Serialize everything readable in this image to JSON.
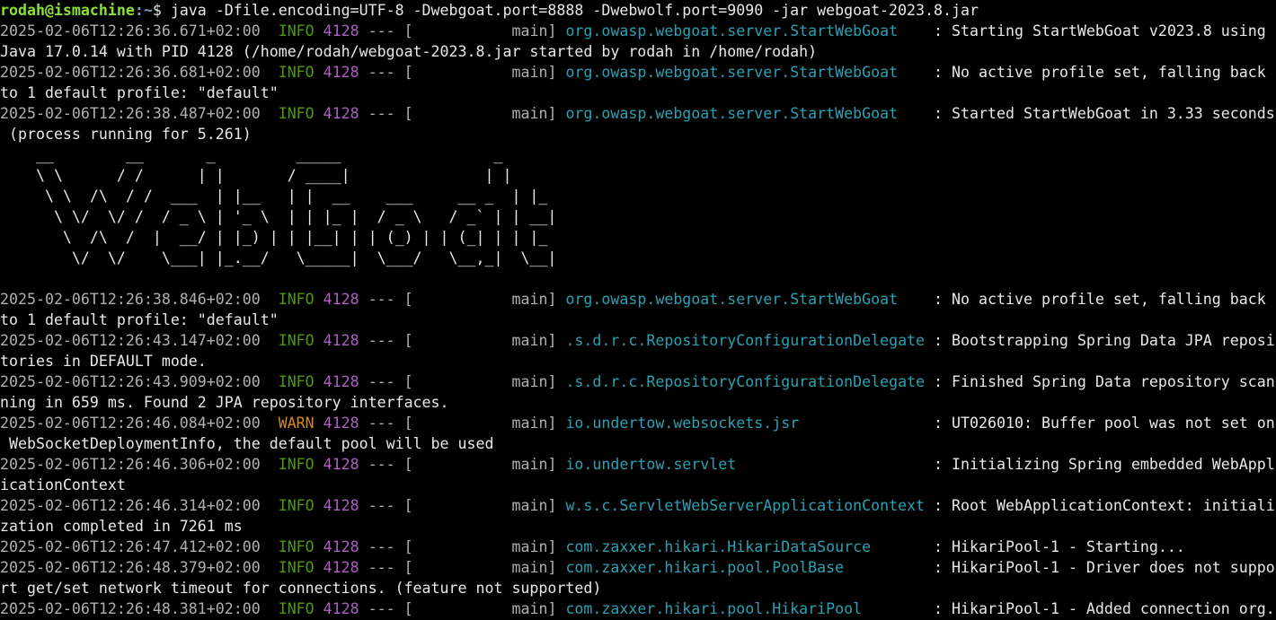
{
  "prompt": {
    "user_host": "rodah@ismachine",
    "path": ":~",
    "symbol": "$ ",
    "command": "java -Dfile.encoding=UTF-8 -Dwebgoat.port=8888 -Dwebwolf.port=9090 -jar webgoat-2023.8.jar"
  },
  "log_entries": [
    {
      "timestamp": "2025-02-06T12:26:36.671+02:00",
      "level": "INFO",
      "pid": "4128",
      "thread": "main",
      "logger": "org.owasp.webgoat.server.StartWebGoat",
      "message": "Starting StartWebGoat v2023.8 using",
      "continuation": "Java 17.0.14 with PID 4128 (/home/rodah/webgoat-2023.8.jar started by rodah in /home/rodah)"
    },
    {
      "timestamp": "2025-02-06T12:26:36.681+02:00",
      "level": "INFO",
      "pid": "4128",
      "thread": "main",
      "logger": "org.owasp.webgoat.server.StartWebGoat",
      "message": "No active profile set, falling back",
      "continuation": "to 1 default profile: \"default\""
    },
    {
      "timestamp": "2025-02-06T12:26:38.487+02:00",
      "level": "INFO",
      "pid": "4128",
      "thread": "main",
      "logger": "org.owasp.webgoat.server.StartWebGoat",
      "message": "Started StartWebGoat in 3.33 seconds",
      "continuation": " (process running for 5.261)"
    }
  ],
  "banner": [
    "    __        __       _         _____                 _   ",
    "    \\ \\      / /      | |       / ____|               | |  ",
    "     \\ \\  /\\  / /  ___  | |__   | |  __    ___     __ _  | |_ ",
    "      \\ \\/  \\/ /  / _ \\ | '_ \\  | | |_ |  / _ \\   / _` | | __|",
    "       \\  /\\  /  |  __/ | |_) | | |__| | | (_) | | (_| | | |_ ",
    "        \\/  \\/    \\___| |_.__/   \\_____|  \\___/   \\__,_|  \\__|",
    ""
  ],
  "log_entries_2": [
    {
      "timestamp": "2025-02-06T12:26:38.846+02:00",
      "level": "INFO",
      "pid": "4128",
      "thread": "main",
      "logger": "org.owasp.webgoat.server.StartWebGoat",
      "message": "No active profile set, falling back",
      "continuation": "to 1 default profile: \"default\""
    },
    {
      "timestamp": "2025-02-06T12:26:43.147+02:00",
      "level": "INFO",
      "pid": "4128",
      "thread": "main",
      "logger": ".s.d.r.c.RepositoryConfigurationDelegate",
      "message": "Bootstrapping Spring Data JPA reposi",
      "continuation": "tories in DEFAULT mode."
    },
    {
      "timestamp": "2025-02-06T12:26:43.909+02:00",
      "level": "INFO",
      "pid": "4128",
      "thread": "main",
      "logger": ".s.d.r.c.RepositoryConfigurationDelegate",
      "message": "Finished Spring Data repository scan",
      "continuation": "ning in 659 ms. Found 2 JPA repository interfaces."
    },
    {
      "timestamp": "2025-02-06T12:26:46.084+02:00",
      "level": "WARN",
      "pid": "4128",
      "thread": "main",
      "logger": "io.undertow.websockets.jsr",
      "message": "UT026010: Buffer pool was not set on",
      "continuation": " WebSocketDeploymentInfo, the default pool will be used"
    },
    {
      "timestamp": "2025-02-06T12:26:46.306+02:00",
      "level": "INFO",
      "pid": "4128",
      "thread": "main",
      "logger": "io.undertow.servlet",
      "message": "Initializing Spring embedded WebAppl",
      "continuation": "icationContext"
    },
    {
      "timestamp": "2025-02-06T12:26:46.314+02:00",
      "level": "INFO",
      "pid": "4128",
      "thread": "main",
      "logger": "w.s.c.ServletWebServerApplicationContext",
      "message": "Root WebApplicationContext: initiali",
      "continuation": "zation completed in 7261 ms"
    },
    {
      "timestamp": "2025-02-06T12:26:47.412+02:00",
      "level": "INFO",
      "pid": "4128",
      "thread": "main",
      "logger": "com.zaxxer.hikari.HikariDataSource",
      "message": "HikariPool-1 - Starting...",
      "continuation": null
    },
    {
      "timestamp": "2025-02-06T12:26:48.379+02:00",
      "level": "INFO",
      "pid": "4128",
      "thread": "main",
      "logger": "com.zaxxer.hikari.pool.PoolBase",
      "message": "HikariPool-1 - Driver does not suppo",
      "continuation": "rt get/set network timeout for connections. (feature not supported)"
    },
    {
      "timestamp": "2025-02-06T12:26:48.381+02:00",
      "level": "INFO",
      "pid": "4128",
      "thread": "main",
      "logger": "com.zaxxer.hikari.pool.HikariPool",
      "message": "HikariPool-1 - Added connection org.",
      "continuation": null
    }
  ],
  "colors": {
    "background": "#000000",
    "text": "#e8e8e8",
    "prompt_user": "#8ae234",
    "prompt_path": "#729fcf",
    "timestamp": "#b0b0b0",
    "info": "#4e9a06",
    "warn": "#d08a1e",
    "pid": "#ad5fc2",
    "logger": "#2aa1b3"
  }
}
